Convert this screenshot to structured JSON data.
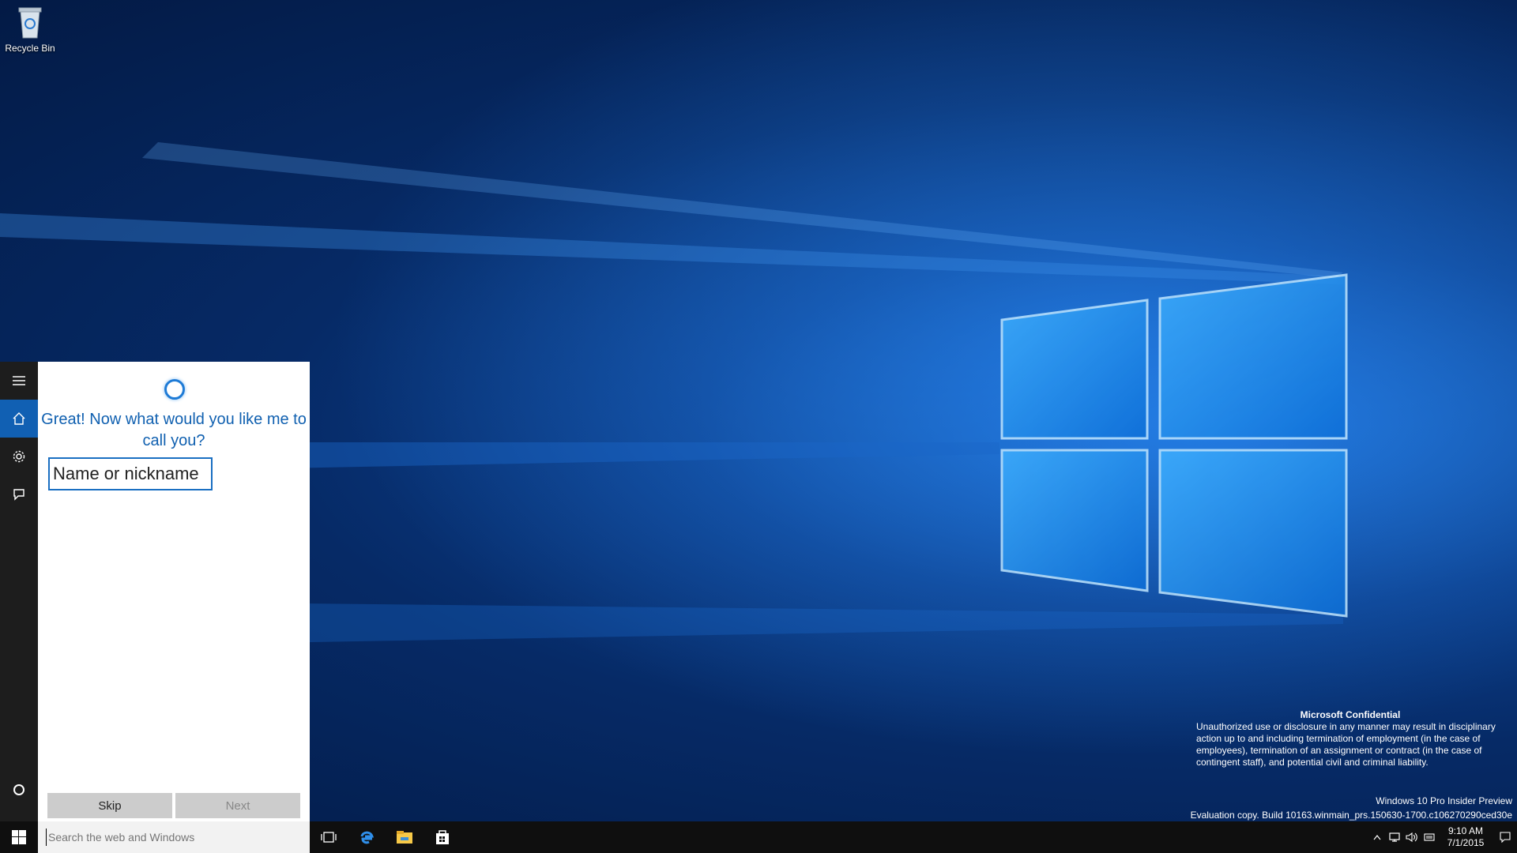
{
  "desktop": {
    "icons": [
      {
        "label": "Recycle Bin",
        "icon": "recycle-bin-icon"
      }
    ]
  },
  "watermark": {
    "title": "Microsoft Confidential",
    "body": "Unauthorized use or disclosure in any manner may result in disciplinary action up to and including termination of employment (in the case of employees), termination of an assignment or contract (in the case of contingent staff), and potential civil and criminal liability.",
    "edition": "Windows 10 Pro Insider Preview",
    "build": "Evaluation copy. Build 10163.winmain_prs.150630-1700.c106270290ced30e"
  },
  "cortana": {
    "rail": [
      {
        "icon": "hamburger-menu-icon"
      },
      {
        "icon": "home-icon"
      },
      {
        "icon": "gear-icon"
      },
      {
        "icon": "feedback-icon"
      }
    ],
    "prompt": "Great! Now what would you like me to call you?",
    "name_input": {
      "placeholder": "Name or nickname",
      "value": ""
    },
    "skip_label": "Skip",
    "next_label": "Next"
  },
  "taskbar": {
    "search_placeholder": "Search the web and Windows",
    "pinned": [
      "task-view-icon",
      "edge-icon",
      "file-explorer-icon",
      "store-icon"
    ],
    "clock_time": "9:10 AM",
    "clock_date": "7/1/2015"
  },
  "colors": {
    "accent": "#1160b3",
    "prompt_text": "#1060b0",
    "taskbar": "#0f0f0f"
  }
}
